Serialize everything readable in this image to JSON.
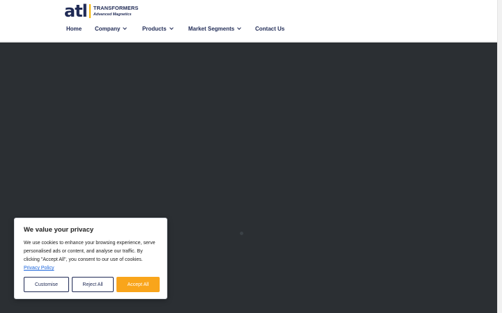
{
  "colors": {
    "brand_navy": "#1f2a55",
    "brand_yellow": "#f5b300",
    "hero_background": "#2b2f33",
    "accept_button": "#f9a51b",
    "link": "#1863dc"
  },
  "header": {
    "logo": {
      "mark": "atl",
      "line1": "TRANSFORMERS",
      "line2": "Advanced Magnetics"
    },
    "nav": [
      {
        "label": "Home",
        "has_dropdown": false
      },
      {
        "label": "Company",
        "has_dropdown": true
      },
      {
        "label": "Products",
        "has_dropdown": true
      },
      {
        "label": "Market Segments",
        "has_dropdown": true
      },
      {
        "label": "Contact Us",
        "has_dropdown": false
      }
    ]
  },
  "cookie_banner": {
    "title": "We value your privacy",
    "body": "We use cookies to enhance your browsing experience, serve personalised ads or content, and analyse our traffic. By clicking \"Accept All\", you consent to our use of cookies.",
    "policy_link": "Privacy Policy",
    "buttons": {
      "customise": "Customise",
      "reject": "Reject All",
      "accept": "Accept All"
    }
  }
}
